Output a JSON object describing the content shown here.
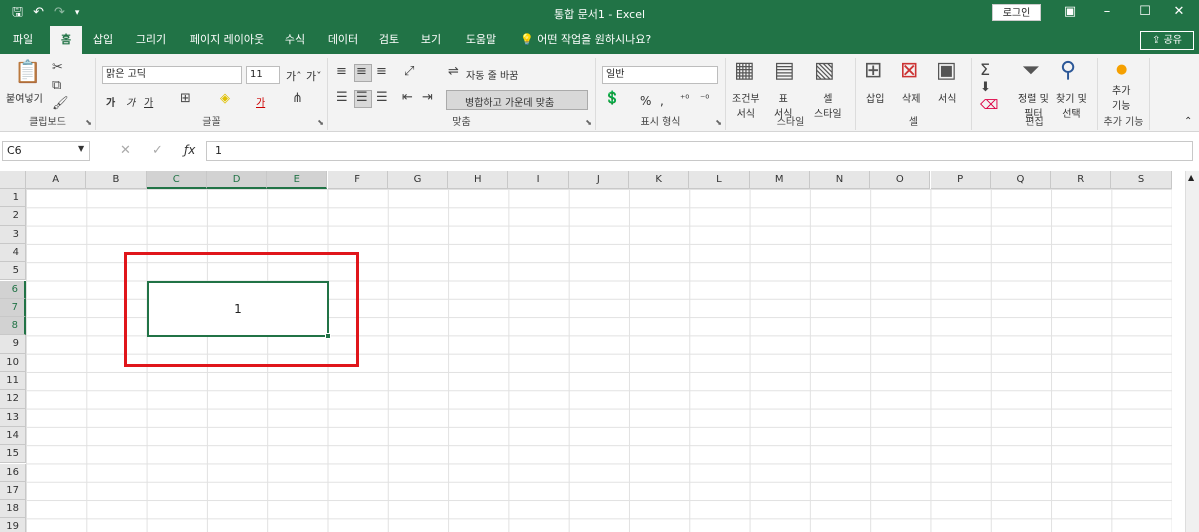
{
  "title_bar": {
    "title": "통합 문서1  -  Excel",
    "login": "로그인",
    "save_icon": "save-icon",
    "undo_icon": "undo-icon",
    "redo_icon": "redo-icon"
  },
  "tabs": [
    "파일",
    "홈",
    "삽입",
    "그리기",
    "페이지 레이아웃",
    "수식",
    "데이터",
    "검토",
    "보기",
    "도움말"
  ],
  "active_tab": "홈",
  "tell_me": "어떤 작업을 원하시나요?",
  "share": "공유",
  "ribbon": {
    "clipboard": {
      "paste": "붙여넣기",
      "label": "클립보드"
    },
    "font": {
      "name": "맑은 고딕",
      "size": "11",
      "bold": "가",
      "italic": "가",
      "underline": "가",
      "label": "글꼴"
    },
    "alignment": {
      "wrap": "자동 줄 바꿈",
      "merge": "병합하고 가운데 맞춤",
      "label": "맞춤"
    },
    "number": {
      "format": "일반",
      "percent": "%",
      "comma": ",",
      "label": "표시 형식"
    },
    "styles": {
      "conditional": "조건부\n서식",
      "table": "표\n서식",
      "cell": "셀\n스타일",
      "label": "스타일"
    },
    "cells": {
      "insert": "삽입",
      "delete": "삭제",
      "format": "서식",
      "label": "셀"
    },
    "editing": {
      "sort": "정렬 및\n필터",
      "find": "찾기 및\n선택",
      "label": "편집"
    },
    "addins": {
      "addins": "추가\n기능",
      "label": "추가 기능"
    }
  },
  "formula_bar": {
    "name_box": "C6",
    "value": "1"
  },
  "columns": [
    "A",
    "B",
    "C",
    "D",
    "E",
    "F",
    "G",
    "H",
    "I",
    "J",
    "K",
    "L",
    "M",
    "N",
    "O",
    "P",
    "Q",
    "R",
    "S"
  ],
  "selected_columns": [
    "C",
    "D",
    "E"
  ],
  "rows": [
    "1",
    "2",
    "3",
    "4",
    "5",
    "6",
    "7",
    "8",
    "9",
    "10",
    "11",
    "12",
    "13",
    "14",
    "15",
    "16",
    "17",
    "18",
    "19"
  ],
  "selected_rows": [
    "6",
    "7",
    "8"
  ],
  "merged_cell": {
    "value": "1"
  },
  "colors": {
    "accent": "#217346",
    "highlight": "#e0161b"
  }
}
